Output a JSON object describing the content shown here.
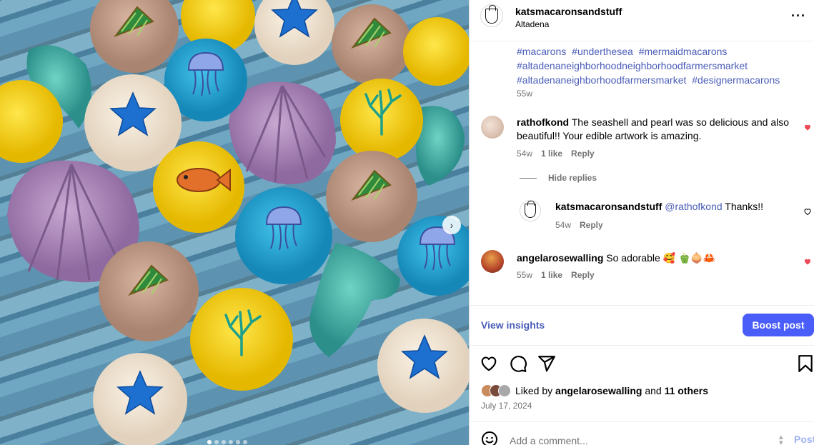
{
  "post": {
    "username": "katsmacaronsandstuff",
    "location": "Altadena",
    "more_icon": "more-horizontal-icon",
    "caption_tags": [
      "#macarons",
      "#underthesea",
      "#mermaidmacarons",
      "#altadenaneighborhoodneighborhoodfarmersmarket",
      "#altadenaneighborhoodfarmersmarket",
      "#designermacarons"
    ],
    "caption_time": "55w"
  },
  "comments": [
    {
      "username": "rathofkond",
      "text": "The seashell and pearl was so delicious and also beautiful!! Your edible artwork is amazing.",
      "time": "54w",
      "likes": "1 like",
      "reply": "Reply",
      "liked": true
    },
    {
      "username": "katsmacaronsandstuff",
      "mention": "@rathofkond",
      "text": "Thanks!!",
      "time": "54w",
      "reply": "Reply",
      "liked": false
    },
    {
      "username": "angelarosewalling",
      "text": "So adorable 🥰 🫑🧅🦀",
      "time": "55w",
      "likes": "1 like",
      "reply": "Reply",
      "liked": true
    }
  ],
  "hide_replies": "Hide replies",
  "actions": {
    "view_insights": "View insights",
    "boost_post": "Boost post"
  },
  "likes": {
    "prefix": "Liked by",
    "user": "angelarosewalling",
    "conj": "and",
    "others": "11 others"
  },
  "post_date": "July 17, 2024",
  "add_comment": {
    "placeholder": "Add a comment...",
    "post_label": "Post"
  },
  "colors": {
    "link": "#4a5db8",
    "boost": "#4a5df9",
    "like": "#ed4956",
    "muted": "#737373"
  }
}
